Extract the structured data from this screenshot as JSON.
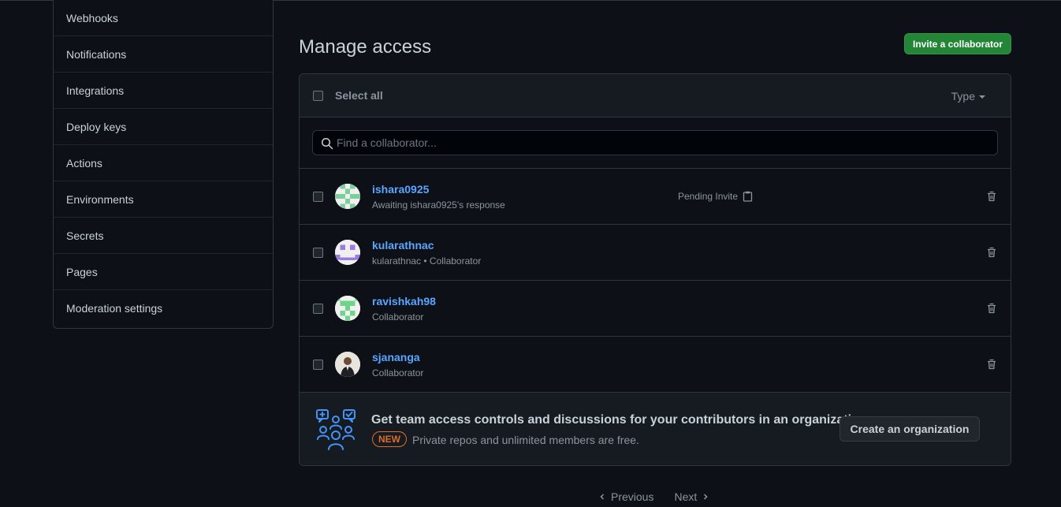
{
  "sidebar": {
    "items": [
      {
        "label": "Webhooks"
      },
      {
        "label": "Notifications"
      },
      {
        "label": "Integrations"
      },
      {
        "label": "Deploy keys"
      },
      {
        "label": "Actions"
      },
      {
        "label": "Environments"
      },
      {
        "label": "Secrets"
      },
      {
        "label": "Pages"
      },
      {
        "label": "Moderation settings"
      }
    ]
  },
  "header": {
    "title": "Manage access",
    "invite_label": "Invite a collaborator"
  },
  "box": {
    "select_all_label": "Select all",
    "type_label": "Type",
    "search_placeholder": "Find a collaborator..."
  },
  "members": [
    {
      "name": "ishara0925",
      "sub": "Awaiting ishara0925's response",
      "status": "Pending Invite",
      "avatar": "identicon-green-a"
    },
    {
      "name": "kularathnac",
      "sub": "kularathnac • Collaborator",
      "status": "",
      "avatar": "identicon-purple"
    },
    {
      "name": "ravishkah98",
      "sub": "Collaborator",
      "status": "",
      "avatar": "identicon-green-b"
    },
    {
      "name": "sjananga",
      "sub": "Collaborator",
      "status": "",
      "avatar": "photo-person"
    }
  ],
  "promo": {
    "title": "Get team access controls and discussions for your contributors in an organization.",
    "badge": "NEW",
    "subtitle": "Private repos and unlimited members are free.",
    "button_label": "Create an organization"
  },
  "pagination": {
    "previous_label": "Previous",
    "next_label": "Next"
  },
  "colors": {
    "background": "#0d1117",
    "accent_green": "#238636",
    "link_blue": "#58a6ff",
    "badge_orange": "#db6d28"
  }
}
